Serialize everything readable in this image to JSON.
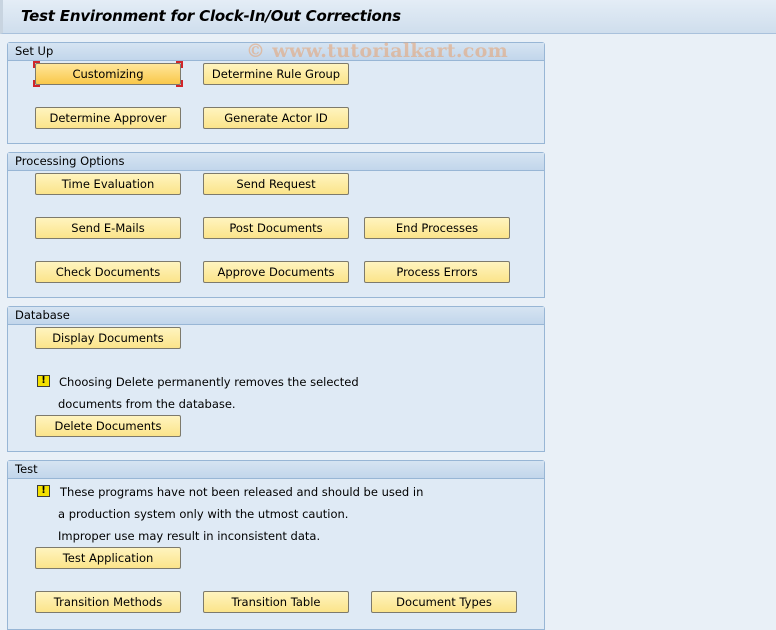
{
  "header": {
    "title": "Test Environment for Clock-In/Out Corrections"
  },
  "watermark": "© www.tutorialkart.com",
  "groups": {
    "setup": {
      "title": "Set Up",
      "buttons": [
        "Customizing",
        "Determine Rule Group",
        "Determine Approver",
        "Generate Actor ID"
      ],
      "focused_button": "Customizing"
    },
    "processing": {
      "title": "Processing Options",
      "buttons": [
        "Time Evaluation",
        "Send Request",
        "Send E-Mails",
        "Post Documents",
        "End Processes",
        "Check Documents",
        "Approve Documents",
        "Process Errors"
      ]
    },
    "database": {
      "title": "Database",
      "buttons": [
        "Display Documents",
        "Delete Documents"
      ],
      "warning_icon": "warning-icon",
      "warning_lines": [
        "Choosing Delete permanently removes the selected",
        "documents from the database."
      ]
    },
    "test": {
      "title": "Test",
      "buttons": [
        "Test Application",
        "Transition Methods",
        "Transition Table",
        "Document Types"
      ],
      "warning_icon": "warning-icon",
      "warning_lines": [
        "These programs have not been released and should be used in",
        "a production system only with the utmost caution.",
        "Improper use may result in inconsistent data."
      ]
    }
  },
  "colors": {
    "button_fill": "#fbe48a",
    "focus_marker": "#d1252a",
    "group_border": "#98b6d5",
    "background": "#e9f0f7"
  }
}
